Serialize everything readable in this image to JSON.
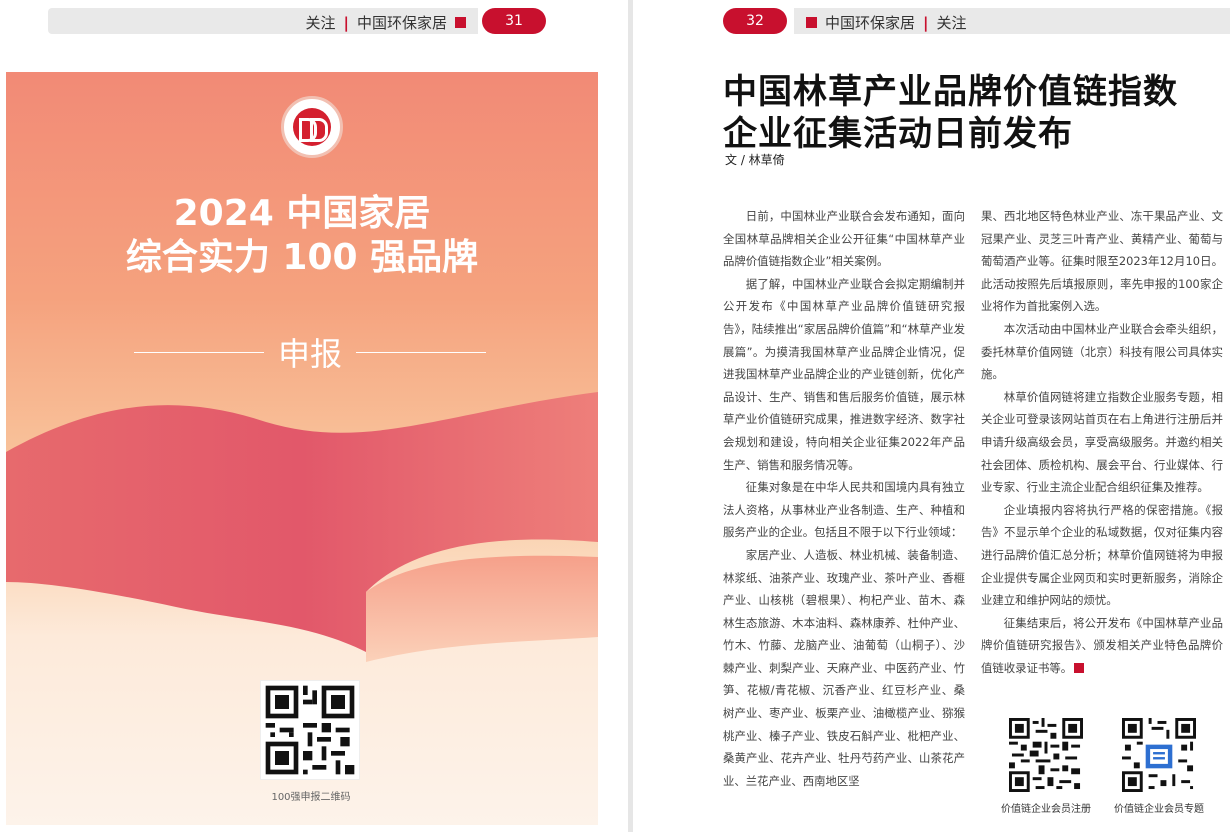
{
  "left_page": {
    "header": {
      "follow": "关注",
      "column": "中国环保家居"
    },
    "page_number": "31",
    "poster": {
      "title_line1": "2024 中国家居",
      "title_line2": "综合实力 100 强品牌",
      "apply": "申报",
      "qr_label": "100强申报二维码"
    }
  },
  "right_page": {
    "page_number": "32",
    "header": {
      "column": "中国环保家居",
      "follow": "关注"
    },
    "title_line1": "中国林草产业品牌价值链指数",
    "title_line2": "企业征集活动日前发布",
    "byline": "文 / 林草倚",
    "col1": {
      "p1": "日前，中国林业产业联合会发布通知，面向全国林草品牌相关企业公开征集“中国林草产业品牌价值链指数企业”相关案例。",
      "p2": "据了解，中国林业产业联合会拟定期编制并公开发布《中国林草产业品牌价值链研究报告》，陆续推出“家居品牌价值篇”和“林草产业发展篇”。为摸清我国林草产业品牌企业情况，促进我国林草产业品牌企业的产业链创新，优化产品设计、生产、销售和售后服务价值链，展示林草产业价值链研究成果，推进数字经济、数字社会规划和建设，特向相关企业征集2022年产品生产、销售和服务情况等。",
      "p3": "征集对象是在中华人民共和国境内具有独立法人资格，从事林业产业各制造、生产、种植和服务产业的企业。包括且不限于以下行业领域：",
      "p4": "家居产业、人造板、林业机械、装备制造、林浆纸、油茶产业、玫瑰产业、茶叶产业、香榧产业、山核桃（碧根果）、枸杞产业、苗木、森林生态旅游、木本油料、森林康养、杜仲产业、竹木、竹藤、龙脑产业、油葡萄（山桐子）、沙棘产业、刺梨产业、天麻产业、中医药产业、竹笋、花椒/青花椒、沉香产业、红豆杉产业、桑树产业、枣产业、板栗产业、油橄榄产业、猕猴桃产业、榛子产业、铁皮石斛产业、枇杷产业、桑黄产业、花卉产业、牡丹芍药产业、山茶花产业、兰花产业、西南地区坚"
    },
    "col2": {
      "p1": "果、西北地区特色林业产业、冻干果品产业、文冠果产业、灵芝三叶青产业、黄精产业、葡萄与葡萄酒产业等。征集时限至2023年12月10日。此活动按照先后填报原则，率先申报的100家企业将作为首批案例入选。",
      "p2": "本次活动由中国林业产业联合会牵头组织，委托林草价值网链（北京）科技有限公司具体实施。",
      "p3": "林草价值网链将建立指数企业服务专题，相关企业可登录该网站首页在右上角进行注册后并申请升级高级会员，享受高级服务。并邀约相关社会团体、质检机构、展会平台、行业媒体、行业专家、行业主流企业配合组织征集及推荐。",
      "p4": "企业填报内容将执行严格的保密措施。《报告》不显示单个企业的私域数据，仅对征集内容进行品牌价值汇总分析；林草价值网链将为申报企业提供专属企业网页和实时更新服务，消除企业建立和维护网站的烦忧。",
      "p5": "征集结束后，将公开发布《中国林草产业品牌价值链研究报告》、颁发相关产业特色品牌价值链收录证书等。"
    },
    "qr_codes": [
      {
        "label": "价值链企业会员注册"
      },
      {
        "label": "价值链企业会员专题"
      }
    ]
  },
  "colors": {
    "accent_red": "#c8102e",
    "poster_top": "#f28a76",
    "poster_bottom": "#fdf3ea"
  }
}
